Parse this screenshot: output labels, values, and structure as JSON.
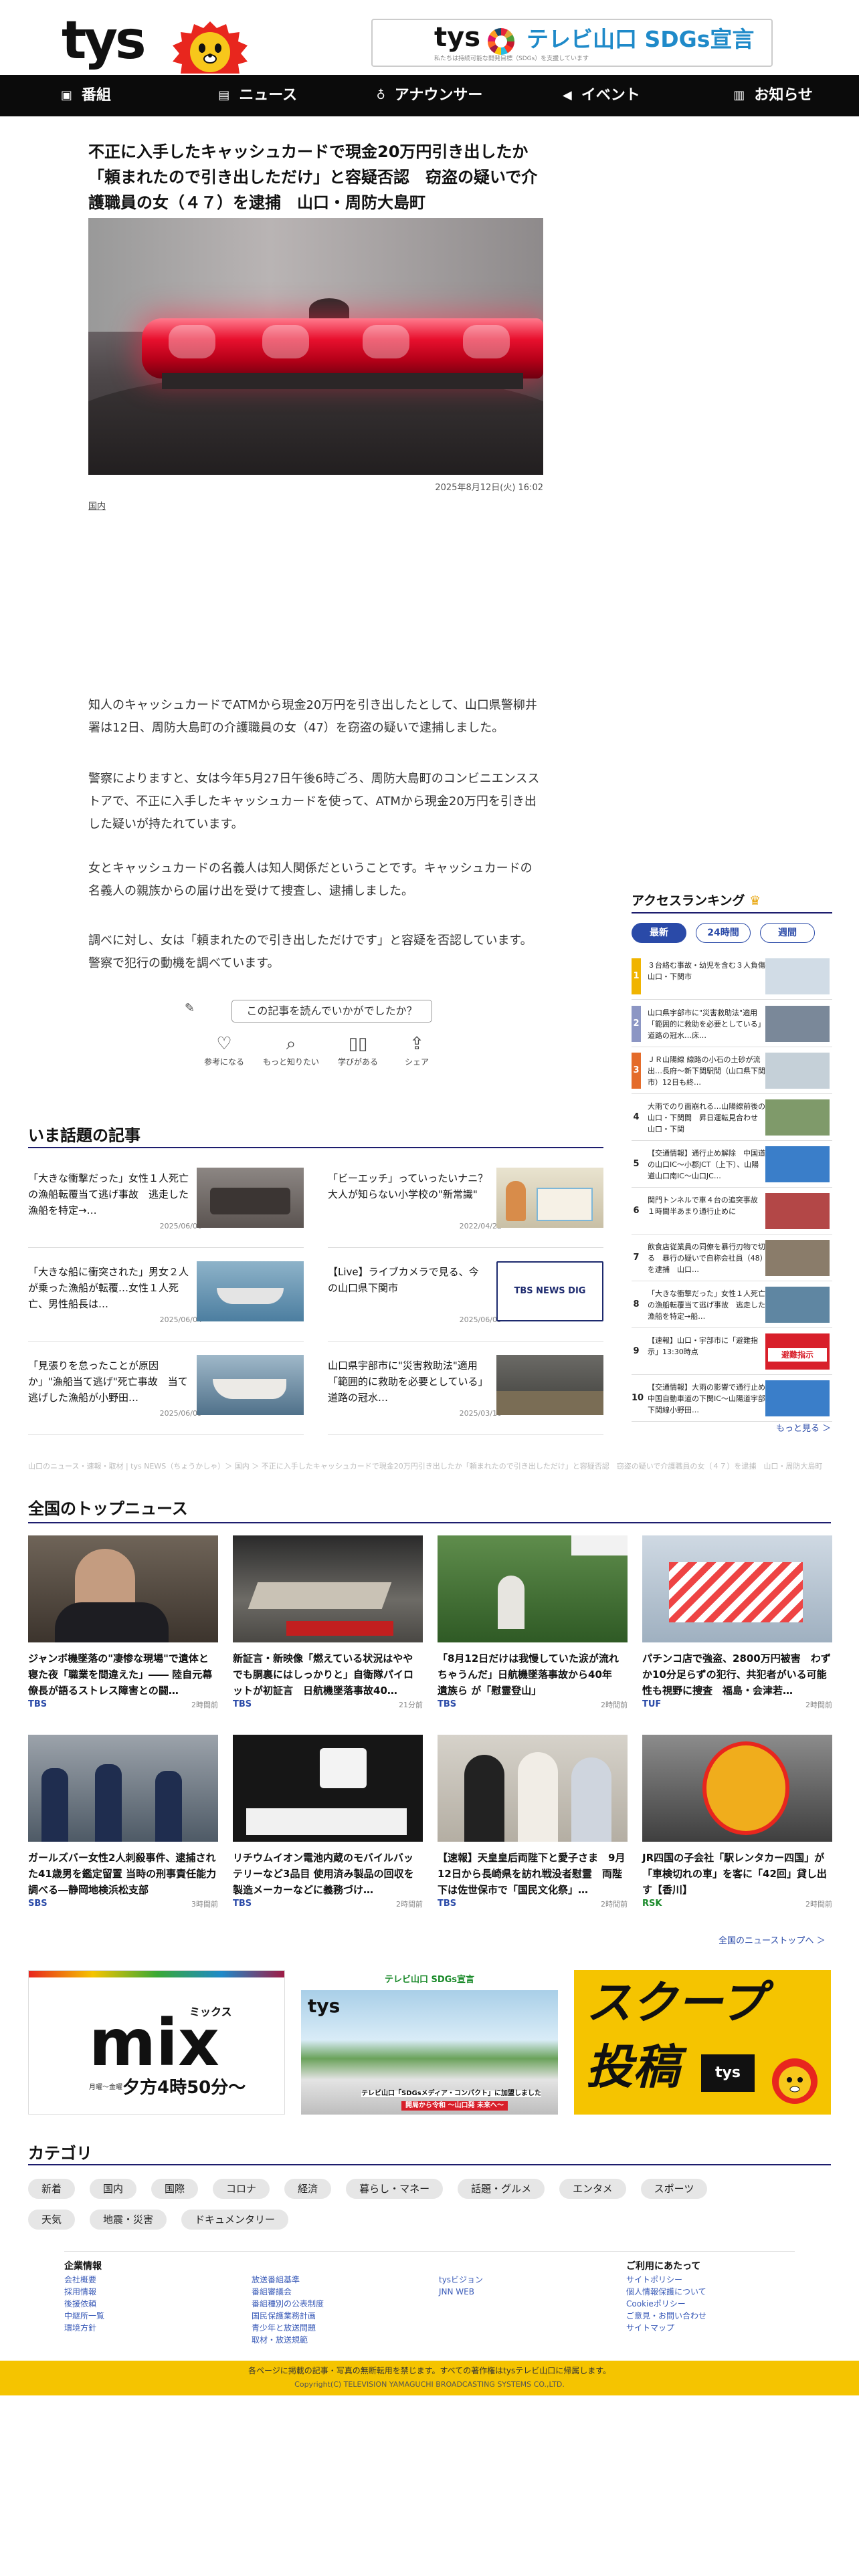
{
  "header": {
    "logo": "tys",
    "sdgs_logo": "tys",
    "sdgs_title": "テレビ山口 SDGs宣言",
    "sdgs_sub": "私たちは持続可能な開発目標（SDGs）を支援しています"
  },
  "nav": [
    {
      "label": "番組",
      "icon": "tv-icon"
    },
    {
      "label": "ニュース",
      "icon": "news-icon"
    },
    {
      "label": "アナウンサー",
      "icon": "microphone-icon"
    },
    {
      "label": "イベント",
      "icon": "megaphone-icon"
    },
    {
      "label": "お知らせ",
      "icon": "notice-icon"
    }
  ],
  "article": {
    "title": "不正に入手したキャッシュカードで現金20万円引き出したか「頼まれたので引き出しただけ」と容疑否認　窃盗の疑いで介護職員の女（４７）を逮捕　山口・周防大島町",
    "date": "2025年8月12日(火) 16:02",
    "category": "国内",
    "paragraphs": [
      "知人のキャッシュカードでATMから現金20万円を引き出したとして、山口県警柳井署は12日、周防大島町の介護職員の女（47）を窃盗の疑いで逮捕しました。",
      "警察によりますと、女は今年5月27日午後6時ごろ、周防大島町のコンビニエンスストアで、不正に入手したキャッシュカードを使って、ATMから現金20万円を引き出した疑いが持たれています。",
      "女とキャッシュカードの名義人は知人関係だということです。キャッシュカードの名義人の親族からの届け出を受けて捜査し、逮捕しました。",
      "調べに対し、女は「頼まれたので引き出しただけです」と容疑を否認しています。警察で犯行の動機を調べています。"
    ],
    "question": "この記事を読んでいかがでしたか？",
    "reactions": [
      {
        "label": "参考になる",
        "icon": "lightbulb-icon"
      },
      {
        "label": "もっと知りたい",
        "icon": "magnifier-icon"
      },
      {
        "label": "学びがある",
        "icon": "book-icon"
      },
      {
        "label": "シェア",
        "icon": "share-icon"
      }
    ]
  },
  "hot": {
    "title": "いま話題の記事",
    "items": [
      {
        "title": "「大きな衝撃だった」女性１人死亡の漁船転覆当て逃げ事故　逃走した漁船を特定→…",
        "date": "2025/06/06"
      },
      {
        "title": "「ビーエッチ」っていったいナニ？大人が知らない小学校の\"新常識\"",
        "date": "2022/04/22"
      },
      {
        "title": "「大きな船に衝突された」男女２人が乗った漁船が転覆…女性１人死亡、男性船長は…",
        "date": "2025/06/04"
      },
      {
        "title": "【Live】ライブカメラで見る、今の山口県下関市",
        "date": "2025/06/09"
      },
      {
        "title": "「見張りを怠ったことが原因か」\"漁船当て逃げ\"死亡事故　当て逃げした漁船が小野田…",
        "date": "2025/06/09"
      },
      {
        "title": "山口県宇部市に\"災害救助法\"適用「範囲的に救助を必要としている」道路の冠水…",
        "date": "2025/03/10"
      }
    ]
  },
  "ranking": {
    "title": "アクセスランキング",
    "tabs": [
      "最新",
      "24時間",
      "週間"
    ],
    "items": [
      {
        "rank": "1",
        "title": "３台絡む事故・幼児を含む３人負傷　山口・下関市",
        "color": "#f0b400"
      },
      {
        "rank": "2",
        "title": "山口県宇部市に\"災害救助法\"適用「範囲的に救助を必要としている」道路の冠水…床…",
        "color": "#8c96c4"
      },
      {
        "rank": "3",
        "title": "ＪＲ山陽線 線路の小石の土砂が流出…長府～新下関駅間（山口県下関市）12日も終…",
        "color": "#e46b2a"
      },
      {
        "rank": "4",
        "title": "大雨でのり面崩れる…山陽線前後の山口・下関間　昇日運転見合わせ　山口・下関",
        "color": "#ffffff"
      },
      {
        "rank": "5",
        "title": "【交通情報】通行止め解除　中国道の山口IC～小郡JCT（上下）、山陽道山口南IC～山口JC…",
        "color": "#ffffff"
      },
      {
        "rank": "6",
        "title": "関門トンネルで車４台の追突事故 １時間半あまり通行止めに",
        "color": "#ffffff"
      },
      {
        "rank": "7",
        "title": "飲食店従業員の同僚を暴行刃物で切る　暴行の疑いで自称会社員（48）を逮捕　山口…",
        "color": "#ffffff"
      },
      {
        "rank": "8",
        "title": "「大きな衝撃だった」女性１人死亡の漁船転覆当て逃げ事故　逃走した漁船を特定→船…",
        "color": "#ffffff"
      },
      {
        "rank": "9",
        "title": "【速報】山口・宇部市に「避難指示」13:30時点",
        "color": "#ffffff"
      },
      {
        "rank": "10",
        "title": "【交通情報】大雨の影響で通行止め　中国自動車道の下関IC～山陽道宇部下関線小野田…",
        "color": "#ffffff"
      }
    ],
    "badge_text": "避難指示",
    "more": "もっと見る ＞"
  },
  "breadcrumb": "山口のニュース・速報・取材 | tys NEWS（ちょうかしゃ）＞ 国内 ＞ 不正に入手したキャッシュカードで現金20万円引き出したか「頼まれたので引き出しただけ」と容疑否認　窃盗の疑いで介護職員の女（４７）を逮捕　山口・周防大島町",
  "national": {
    "title": "全国のトップニュース",
    "cards": [
      {
        "title": "ジャンボ機墜落の\"凄惨な現場\"で遺体と寝た夜「職業を間違えた」―― 陸自元幕僚長が語るストレス障害との闘…",
        "source": "TBS",
        "time": "2時間前"
      },
      {
        "title": "新証言・新映像「燃えている状況はややでも胴裏にはしっかりと」自衛隊パイロットが初証言　日航機墜落事故40…",
        "source": "TBS",
        "time": "21分前"
      },
      {
        "title": "「8月12日だけは我慢していた涙が流れちゃうんだ」日航機墜落事故から40年　遺族ら が「慰霊登山」",
        "source": "TBS",
        "time": "2時間前"
      },
      {
        "title": "パチンコ店で強盗、2800万円被害　わずか10分足らずの犯行、共犯者がいる可能性も視野に捜査　福島・会津若…",
        "source": "TUF",
        "time": "2時間前"
      },
      {
        "title": "ガールズバー女性2人刺殺事件、逮捕された41歳男を鑑定留置 当時の刑事責任能力調べる―静岡地検浜松支部",
        "source": "SBS",
        "time": "3時間前"
      },
      {
        "title": "リチウムイオン電池内蔵のモバイルバッテリーなど3品目 使用済み製品の回収を製造メーカーなどに義務づけ…",
        "source": "TBS",
        "time": "2時間前"
      },
      {
        "title": "【速報】天皇皇后両陛下と愛子さま　9月12日から長崎県を訪れ戦没者慰霊　両陛下は佐世保市で「国民文化祭」…",
        "source": "TBS",
        "time": "2時間前"
      },
      {
        "title": "JR四国の子会社「駅レンタカー四国」が「車検切れの車」を客に「42回」貸し出す【香川】",
        "source": "RSK",
        "time": "2時間前"
      }
    ],
    "more": "全国のニューストップへ ＞"
  },
  "banners": {
    "mix_title": "mix",
    "mix_kana": "ミックス",
    "mix_time": "夕方4時50分～",
    "mix_days": "月曜～金曜",
    "sdgs_label": "テレビ山口 SDGs宣言",
    "sdgs_logo": "tys",
    "sdgs_note1": "テレビ山口「SDGsメディア・コンパクト」に加盟しました",
    "sdgs_note2": "開局から令和 ～山口発 未来へ～",
    "scoop_title": "スクープ",
    "scoop_sub": "投稿",
    "scoop_logo": "tys"
  },
  "category": {
    "title": "カテゴリ",
    "row1": [
      "新着",
      "国内",
      "国際",
      "コロナ",
      "経済",
      "暮らし・マネー",
      "話題・グルメ",
      "エンタメ",
      "スポーツ"
    ],
    "row2": [
      "天気",
      "地震・災害",
      "ドキュメンタリー"
    ]
  },
  "footer": {
    "col1_title": "企業情報",
    "col1": [
      "会社概要",
      "採用情報",
      "後援依頼",
      "中継所一覧",
      "環境方針"
    ],
    "col2": [
      "放送番組基準",
      "番組審議会",
      "番組種別の公表制度",
      "国民保護業務計画",
      "青少年と放送問題",
      "取材・放送規範"
    ],
    "col3": [
      "tysビジョン",
      "JNN WEB"
    ],
    "col4_title": "ご利用にあたって",
    "col4": [
      "サイトポリシー",
      "個人情報保護について",
      "Cookieポリシー",
      "ご意見・お問い合わせ",
      "サイトマップ"
    ],
    "notice": "各ページに掲載の記事・写真の無断転用を禁じます。すべての著作権はtysテレビ山口に帰属します。",
    "copyright": "Copyright(C) TELEVISION YAMAGUCHI BROADCASTING SYSTEMS CO.,LTD."
  }
}
